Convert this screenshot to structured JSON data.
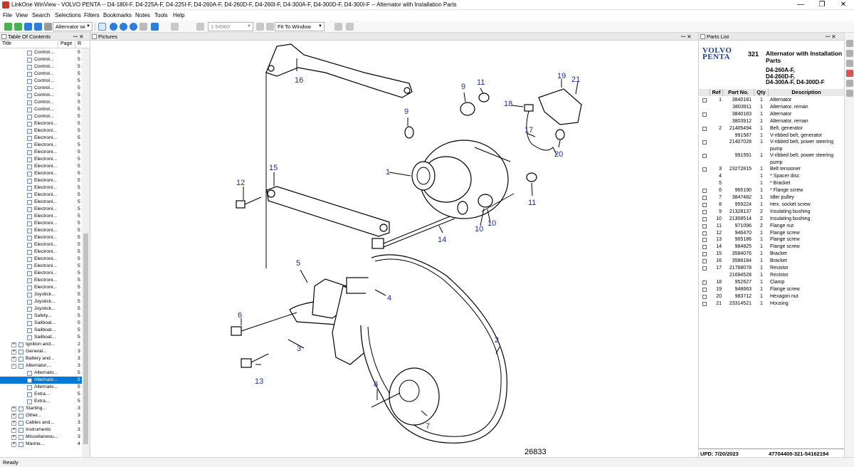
{
  "window": {
    "title": "LinkOne WinView - VOLVO PENTA -- D4-180I-F, D4-225A-F, D4-225I-F, D4-260A-F, D4-260D-F, D4-260I-F, D4-300A-F, D4-300D-F, D4-300I-F -- Alternator with Installation Parts",
    "minimize": "—",
    "restore": "❐",
    "close": "✕"
  },
  "menu": [
    "File",
    "View",
    "Search",
    "Selections",
    "Filters",
    "Bookmarks",
    "Notes",
    "Tools",
    "Help"
  ],
  "toolbar": {
    "book_combo": "Alternator wi",
    "page_combo": "1 54960",
    "zoom_combo": "Fit To Window"
  },
  "toc": {
    "header": "Table Of Contents",
    "pin": "ꟷ ✕",
    "columns": [
      "Title",
      "Page",
      "R"
    ],
    "rows": [
      {
        "label": "Control...",
        "page": "5",
        "level": 3
      },
      {
        "label": "Control...",
        "page": "5",
        "level": 3
      },
      {
        "label": "Control...",
        "page": "5",
        "level": 3
      },
      {
        "label": "Control...",
        "page": "5",
        "level": 3
      },
      {
        "label": "Control...",
        "page": "5",
        "level": 3
      },
      {
        "label": "Control...",
        "page": "5",
        "level": 3
      },
      {
        "label": "Control...",
        "page": "5",
        "level": 3
      },
      {
        "label": "Control...",
        "page": "5",
        "level": 3
      },
      {
        "label": "Control...",
        "page": "5",
        "level": 3
      },
      {
        "label": "Control...",
        "page": "5",
        "level": 3
      },
      {
        "label": "Electroni...",
        "page": "5",
        "level": 3
      },
      {
        "label": "Electroni...",
        "page": "5",
        "level": 3
      },
      {
        "label": "Electroni...",
        "page": "5",
        "level": 3
      },
      {
        "label": "Electroni...",
        "page": "5",
        "level": 3
      },
      {
        "label": "Electroni...",
        "page": "5",
        "level": 3
      },
      {
        "label": "Electroni...",
        "page": "5",
        "level": 3
      },
      {
        "label": "Electroni...",
        "page": "5",
        "level": 3
      },
      {
        "label": "Electroni...",
        "page": "5",
        "level": 3
      },
      {
        "label": "Electroni...",
        "page": "5",
        "level": 3
      },
      {
        "label": "Electroni...",
        "page": "5",
        "level": 3
      },
      {
        "label": "Electroni...",
        "page": "5",
        "level": 3
      },
      {
        "label": "Electroni...",
        "page": "5",
        "level": 3
      },
      {
        "label": "Electroni...",
        "page": "5",
        "level": 3
      },
      {
        "label": "Electroni...",
        "page": "5",
        "level": 3
      },
      {
        "label": "Electroni...",
        "page": "5",
        "level": 3
      },
      {
        "label": "Electroni...",
        "page": "5",
        "level": 3
      },
      {
        "label": "Electroni...",
        "page": "5",
        "level": 3
      },
      {
        "label": "Electroni...",
        "page": "5",
        "level": 3
      },
      {
        "label": "Electroni...",
        "page": "5",
        "level": 3
      },
      {
        "label": "Electroni...",
        "page": "5",
        "level": 3
      },
      {
        "label": "Electroni...",
        "page": "5",
        "level": 3
      },
      {
        "label": "Electroni...",
        "page": "5",
        "level": 3
      },
      {
        "label": "Electroni...",
        "page": "5",
        "level": 3
      },
      {
        "label": "Electroni...",
        "page": "5",
        "level": 3
      },
      {
        "label": "Joystick...",
        "page": "5",
        "level": 3
      },
      {
        "label": "Joystick...",
        "page": "5",
        "level": 3
      },
      {
        "label": "Joystick...",
        "page": "5",
        "level": 3
      },
      {
        "label": "Safety...",
        "page": "5",
        "level": 3
      },
      {
        "label": "Sailboat...",
        "page": "5",
        "level": 3
      },
      {
        "label": "Sailboat...",
        "page": "5",
        "level": 3
      },
      {
        "label": "Sailboat...",
        "page": "5",
        "level": 3
      },
      {
        "label": "Ignition and...",
        "page": "2",
        "level": 2,
        "expander": "+"
      },
      {
        "label": "General...",
        "page": "3",
        "level": 2,
        "expander": "+"
      },
      {
        "label": "Battery and...",
        "page": "3",
        "level": 2,
        "expander": "+"
      },
      {
        "label": "Alternator,...",
        "page": "3",
        "level": 2,
        "expander": "−"
      },
      {
        "label": "Alternato...",
        "page": "5",
        "level": 3
      },
      {
        "label": "Alternato...",
        "page": "5",
        "level": 3,
        "selected": true
      },
      {
        "label": "Alternato...",
        "page": "5",
        "level": 3
      },
      {
        "label": "Extra...",
        "page": "5",
        "level": 3
      },
      {
        "label": "Extra...",
        "page": "5",
        "level": 3
      },
      {
        "label": "Starting...",
        "page": "3",
        "level": 2,
        "expander": "+"
      },
      {
        "label": "Other...",
        "page": "3",
        "level": 2,
        "expander": "+"
      },
      {
        "label": "Cables and...",
        "page": "3",
        "level": 2,
        "expander": "+"
      },
      {
        "label": "Instruments",
        "page": "3",
        "level": 2,
        "expander": "+"
      },
      {
        "label": "Miscellaneou...",
        "page": "3",
        "level": 2,
        "expander": "+"
      },
      {
        "label": "Marine...",
        "page": "4",
        "level": 2,
        "expander": "+"
      }
    ]
  },
  "pictures": {
    "header": "Pictures",
    "pin": "ꟷ ✕",
    "figure_number": "26833",
    "callouts": [
      "1",
      "2",
      "3",
      "4",
      "5",
      "6",
      "7",
      "8",
      "9",
      "9",
      "10",
      "10",
      "11",
      "11",
      "12",
      "13",
      "14",
      "15",
      "16",
      "17",
      "18",
      "19",
      "20",
      "21"
    ]
  },
  "parts": {
    "header": "Parts List",
    "pin": "ꟷ ✕",
    "brand_line1": "VOLVO",
    "brand_line2": "PENTA",
    "section_number": "321",
    "title": "Alternator with Installation Parts",
    "models": [
      "D4-260A-F,",
      "D4-260D-F,",
      "D4-300A-F, D4-300D-F"
    ],
    "columns": [
      "Ref",
      "Part No.",
      "Qty",
      "Description"
    ],
    "rows": [
      {
        "check": true,
        "ref": "1",
        "part": "3840181",
        "qty": "1",
        "desc": "Alternator"
      },
      {
        "check": false,
        "ref": "",
        "part": "3803911",
        "qty": "1",
        "desc": "Alternator, reman"
      },
      {
        "check": true,
        "ref": "",
        "part": "3840183",
        "qty": "1",
        "desc": "Alternator"
      },
      {
        "check": false,
        "ref": "",
        "part": "3803912",
        "qty": "1",
        "desc": "Alternator, reman"
      },
      {
        "check": true,
        "ref": "2",
        "part": "21405494",
        "qty": "1",
        "desc": "Belt, generator"
      },
      {
        "check": false,
        "ref": "",
        "part": "991587",
        "qty": "1",
        "desc": "V-ribbed belt, generator"
      },
      {
        "check": true,
        "ref": "",
        "part": "21407028",
        "qty": "1",
        "desc": "V-ribbed belt, power steering pump",
        "tall": true
      },
      {
        "check": true,
        "ref": "",
        "part": "991591",
        "qty": "1",
        "desc": "V-ribbed belt, power steering pump",
        "tall": true
      },
      {
        "check": true,
        "ref": "3",
        "part": "23272815",
        "qty": "1",
        "desc": "Belt tensioner"
      },
      {
        "check": false,
        "ref": "4",
        "part": "",
        "qty": "1",
        "desc": "*  Spacer disc"
      },
      {
        "check": false,
        "ref": "5",
        "part": "",
        "qty": "1",
        "desc": "*  Bracket"
      },
      {
        "check": true,
        "ref": "6",
        "part": "965190",
        "qty": "1",
        "desc": "*  Flange screw"
      },
      {
        "check": true,
        "ref": "7",
        "part": "3847482",
        "qty": "1",
        "desc": "Idler pulley"
      },
      {
        "check": true,
        "ref": "8",
        "part": "959224",
        "qty": "1",
        "desc": "Hex. socket screw"
      },
      {
        "check": true,
        "ref": "9",
        "part": "21328137",
        "qty": "2",
        "desc": "Insulating bushing"
      },
      {
        "check": true,
        "ref": "10",
        "part": "21308514",
        "qty": "2",
        "desc": "Insulating bushing"
      },
      {
        "check": true,
        "ref": "11",
        "part": "971096",
        "qty": "2",
        "desc": "Flange nut"
      },
      {
        "check": true,
        "ref": "12",
        "part": "946470",
        "qty": "1",
        "desc": "Flange screw"
      },
      {
        "check": true,
        "ref": "13",
        "part": "965186",
        "qty": "1",
        "desc": "Flange screw"
      },
      {
        "check": true,
        "ref": "14",
        "part": "984825",
        "qty": "1",
        "desc": "Flange screw"
      },
      {
        "check": true,
        "ref": "15",
        "part": "3584076",
        "qty": "1",
        "desc": "Bracket"
      },
      {
        "check": true,
        "ref": "16",
        "part": "3588184",
        "qty": "1",
        "desc": "Bracket"
      },
      {
        "check": true,
        "ref": "17",
        "part": "21768078",
        "qty": "1",
        "desc": "Resistor"
      },
      {
        "check": false,
        "ref": "",
        "part": "21694528",
        "qty": "1",
        "desc": "Resistor"
      },
      {
        "check": true,
        "ref": "18",
        "part": "952627",
        "qty": "1",
        "desc": "Clamp"
      },
      {
        "check": true,
        "ref": "19",
        "part": "948663",
        "qty": "1",
        "desc": "Flange screw"
      },
      {
        "check": true,
        "ref": "20",
        "part": "983712",
        "qty": "1",
        "desc": "Hexagon nut"
      },
      {
        "check": true,
        "ref": "21",
        "part": "23314521",
        "qty": "1",
        "desc": "Housing"
      }
    ],
    "footer_left": "UPD: 7/20/2023",
    "footer_right": "47704400-321-54162194"
  },
  "status": "Ready",
  "colors": {
    "selection": "#0078d7",
    "callout": "#1a2e99",
    "brand": "#1c3f95"
  }
}
